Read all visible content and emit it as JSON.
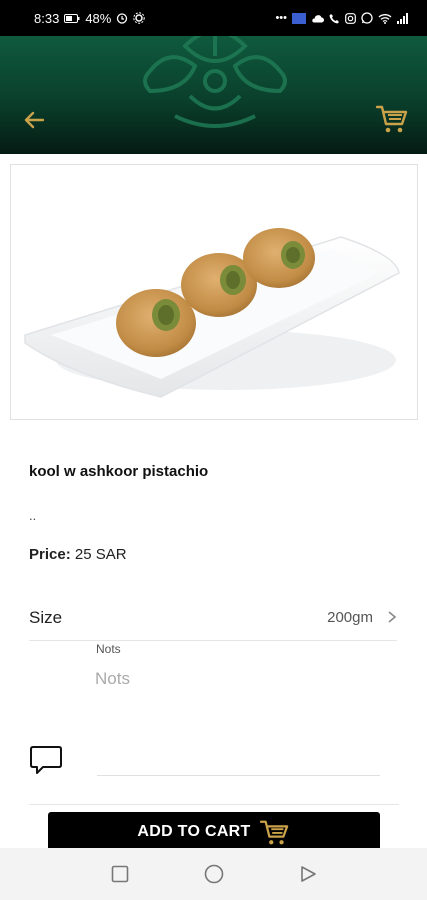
{
  "status_bar": {
    "time": "8:33",
    "battery": "48%",
    "right_icons_text": "•••"
  },
  "header": {
    "back_icon": "back-arrow-icon",
    "cart_icon": "cart-icon",
    "accent_color": "#c9a24a",
    "background_color": "#0a3f2c"
  },
  "product": {
    "name": "kool w ashkoor pistachio",
    "description": "..",
    "price_label": "Price:",
    "price_value": "25 SAR"
  },
  "size": {
    "label": "Size",
    "value": "200gm"
  },
  "notes": {
    "label": "Nots",
    "placeholder": "Nots"
  },
  "actions": {
    "add_to_cart_label": "ADD TO CART"
  },
  "nav": {
    "icons": [
      "recent-apps-icon",
      "home-icon",
      "back-icon"
    ]
  }
}
